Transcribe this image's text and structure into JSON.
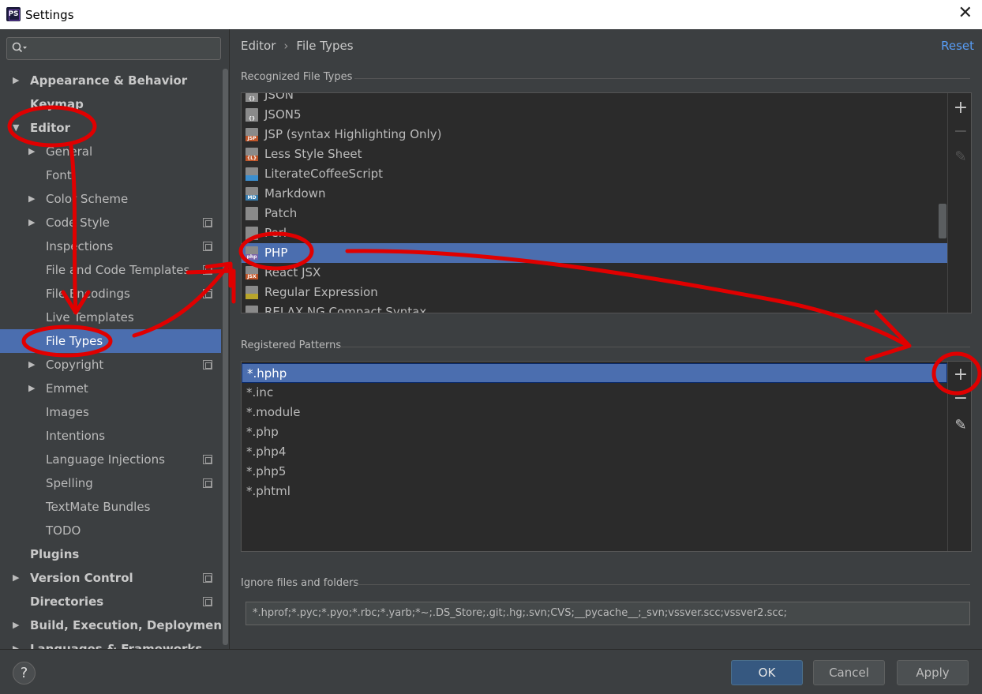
{
  "window": {
    "title": "Settings",
    "app_icon_text": "PS"
  },
  "sidebar": {
    "search_placeholder": "",
    "items": [
      {
        "label": "Appearance & Behavior",
        "level": 0,
        "expandable": true,
        "bold": true
      },
      {
        "label": "Keymap",
        "level": 0,
        "expandable": false,
        "bold": true
      },
      {
        "label": "Editor",
        "level": 0,
        "expanded": true,
        "bold": true
      },
      {
        "label": "General",
        "level": 1,
        "expandable": true
      },
      {
        "label": "Font",
        "level": 1
      },
      {
        "label": "Color Scheme",
        "level": 1,
        "expandable": true
      },
      {
        "label": "Code Style",
        "level": 1,
        "expandable": true,
        "project": true
      },
      {
        "label": "Inspections",
        "level": 1,
        "project": true
      },
      {
        "label": "File and Code Templates",
        "level": 1,
        "project": true
      },
      {
        "label": "File Encodings",
        "level": 1,
        "project": true
      },
      {
        "label": "Live Templates",
        "level": 1
      },
      {
        "label": "File Types",
        "level": 1,
        "selected": true
      },
      {
        "label": "Copyright",
        "level": 1,
        "expandable": true,
        "project": true
      },
      {
        "label": "Emmet",
        "level": 1,
        "expandable": true
      },
      {
        "label": "Images",
        "level": 1
      },
      {
        "label": "Intentions",
        "level": 1
      },
      {
        "label": "Language Injections",
        "level": 1,
        "project": true
      },
      {
        "label": "Spelling",
        "level": 1,
        "project": true
      },
      {
        "label": "TextMate Bundles",
        "level": 1
      },
      {
        "label": "TODO",
        "level": 1
      },
      {
        "label": "Plugins",
        "level": 0,
        "bold": true
      },
      {
        "label": "Version Control",
        "level": 0,
        "expandable": true,
        "bold": true,
        "project": true
      },
      {
        "label": "Directories",
        "level": 0,
        "bold": true,
        "project": true
      },
      {
        "label": "Build, Execution, Deployment",
        "level": 0,
        "expandable": true,
        "bold": true
      },
      {
        "label": "Languages & Frameworks",
        "level": 0,
        "expandable": true,
        "bold": true
      }
    ]
  },
  "header": {
    "breadcrumb": [
      "Editor",
      "File Types"
    ],
    "separator": "›",
    "reset_label": "Reset"
  },
  "recognized": {
    "label": "Recognized File Types",
    "items": [
      {
        "name": "JSON",
        "icon": "json-icon",
        "tag": "{}",
        "color": "#8a8a8a"
      },
      {
        "name": "JSON5",
        "icon": "json5-icon",
        "tag": "{}",
        "color": "#8a8a8a"
      },
      {
        "name": "JSP (syntax Highlighting Only)",
        "icon": "jsp-icon",
        "tag": "JSP",
        "color": "#c0562a"
      },
      {
        "name": "Less Style Sheet",
        "icon": "less-icon",
        "tag": "{L}",
        "color": "#c0562a"
      },
      {
        "name": "LiterateCoffeeScript",
        "icon": "coffeescript-icon",
        "tag": "",
        "color": "#3c8fcf"
      },
      {
        "name": "Markdown",
        "icon": "markdown-icon",
        "tag": "MD",
        "color": "#3a7fb0"
      },
      {
        "name": "Patch",
        "icon": "patch-icon",
        "tag": "",
        "color": "#8a8a8a"
      },
      {
        "name": "Perl",
        "icon": "perl-icon",
        "tag": "",
        "color": "#8a8a8a"
      },
      {
        "name": "PHP",
        "icon": "php-icon",
        "tag": "php",
        "color": "#7b63a8",
        "selected": true
      },
      {
        "name": "React JSX",
        "icon": "jsx-icon",
        "tag": "JSX",
        "color": "#c0562a"
      },
      {
        "name": "Regular Expression",
        "icon": "regex-icon",
        "tag": "",
        "color": "#b8a52b"
      },
      {
        "name": "RELAX NG Compact Syntax",
        "icon": "rnc-icon",
        "tag": "",
        "color": "#8a8a8a"
      }
    ],
    "tools": {
      "add": "+",
      "remove": "−",
      "edit": "✎"
    }
  },
  "patterns": {
    "label": "Registered Patterns",
    "items": [
      "*.hphp",
      "*.inc",
      "*.module",
      "*.php",
      "*.php4",
      "*.php5",
      "*.phtml"
    ],
    "selected_index": 0,
    "tools": {
      "add": "+",
      "remove": "−",
      "edit": "✎"
    }
  },
  "ignore": {
    "label": "Ignore files and folders",
    "value": "*.hprof;*.pyc;*.pyo;*.rbc;*.yarb;*~;.DS_Store;.git;.hg;.svn;CVS;__pycache__;_svn;vssver.scc;vssver2.scc;"
  },
  "footer": {
    "help": "?",
    "ok": "OK",
    "cancel": "Cancel",
    "apply": "Apply"
  },
  "colors": {
    "accent": "#4b6eaf",
    "link": "#589df6",
    "annotation": "#e00000"
  }
}
